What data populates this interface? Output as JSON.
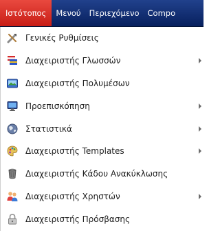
{
  "menubar": {
    "items": [
      {
        "label": "Ιστότοπος",
        "active": true
      },
      {
        "label": "Μενού",
        "active": false
      },
      {
        "label": "Περιεχόμενο",
        "active": false
      },
      {
        "label": "Compo",
        "active": false
      }
    ]
  },
  "dropdown": {
    "items": [
      {
        "label": "Γενικές Ρυθμίσεις",
        "icon": "tools-icon",
        "submenu": false
      },
      {
        "label": "Διαχειριστής Γλωσσών",
        "icon": "language-flags-icon",
        "submenu": true
      },
      {
        "label": "Διαχειριστής Πολυμέσων",
        "icon": "media-image-icon",
        "submenu": false
      },
      {
        "label": "Προεπισκόπηση",
        "icon": "monitor-icon",
        "submenu": true
      },
      {
        "label": "Στατιστικά",
        "icon": "globe-icon",
        "submenu": true
      },
      {
        "label": "Διαχειριστής Templates",
        "icon": "palette-icon",
        "submenu": true
      },
      {
        "label": "Διαχειριστής Κάδου Ανακύκλωσης",
        "icon": "trash-can-icon",
        "submenu": false
      },
      {
        "label": "Διαχειριστής Χρηστών",
        "icon": "users-icon",
        "submenu": true
      },
      {
        "label": "Διαχειριστής Πρόσβασης",
        "icon": "lock-icon",
        "submenu": false
      }
    ]
  },
  "colors": {
    "menubar_bg": "#12307a",
    "menubar_active_bg": "#d8322b",
    "menubar_text": "#ffffff",
    "dropdown_bg": "#ffffff",
    "dropdown_text": "#1c1c1c",
    "arrow": "#6c6c6c"
  }
}
